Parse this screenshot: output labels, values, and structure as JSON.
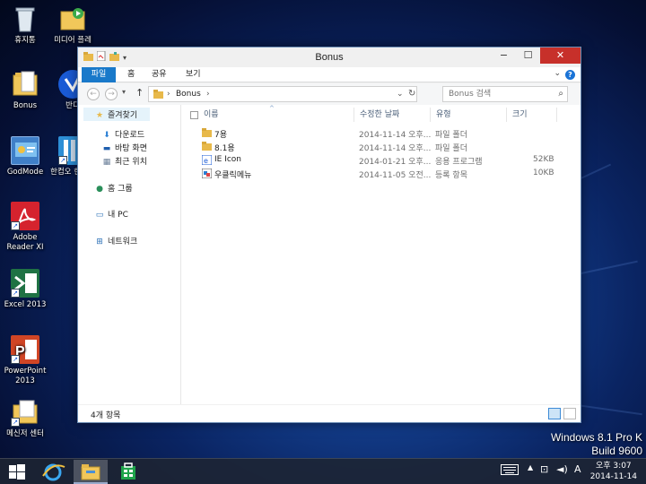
{
  "desktop": {
    "icons": [
      {
        "label": "휴지통",
        "icon": "recycle-bin-icon"
      },
      {
        "label": "Bonus",
        "icon": "folder-icon"
      },
      {
        "label": "GodMode",
        "icon": "control-panel-icon"
      },
      {
        "label": "Adobe Reader XI",
        "icon": "adobe-reader-icon"
      },
      {
        "label": "Excel 2013",
        "icon": "excel-icon"
      },
      {
        "label": "PowerPoint 2013",
        "icon": "powerpoint-icon"
      },
      {
        "label": "메신저 센터",
        "icon": "messenger-folder-icon"
      },
      {
        "label": "미디어 플레",
        "icon": "media-player-folder-icon"
      },
      {
        "label": "반디",
        "icon": "bandi-icon"
      },
      {
        "label": "한컴오 한글 2",
        "icon": "hangul-icon"
      }
    ],
    "watermark": {
      "line1": "Windows 8.1 Pro K",
      "line2": "Build 9600"
    }
  },
  "window": {
    "title": "Bonus",
    "controls": {
      "minimize": "−",
      "maximize": "☐",
      "close": "✕"
    },
    "ribbon_tabs": [
      "파일",
      "홈",
      "공유",
      "보기"
    ],
    "address": {
      "crumbs": [
        "Bonus"
      ]
    },
    "search": {
      "placeholder": "Bonus 검색"
    },
    "nav_pane": {
      "favorites": "즐겨찾기",
      "favorite_items": [
        "다운로드",
        "바탕 화면",
        "최근 위치"
      ],
      "homegroup": "홈 그룹",
      "this_pc": "내 PC",
      "network": "네트워크"
    },
    "columns": [
      "이름",
      "수정한 날짜",
      "유형",
      "크기"
    ],
    "files": [
      {
        "name": "7용",
        "date": "2014-11-14 오후...",
        "type": "파일 폴더",
        "size": "",
        "icon": "folder-icon"
      },
      {
        "name": "8.1용",
        "date": "2014-11-14 오후...",
        "type": "파일 폴더",
        "size": "",
        "icon": "folder-icon"
      },
      {
        "name": "IE Icon",
        "date": "2014-01-21 오후...",
        "type": "응용 프로그램",
        "size": "52KB",
        "icon": "application-icon"
      },
      {
        "name": "우클릭메뉴",
        "date": "2014-11-05 오전...",
        "type": "등록 항목",
        "size": "10KB",
        "icon": "registry-file-icon"
      }
    ],
    "status": "4개 항목"
  },
  "taskbar": {
    "apps": [
      "start-icon",
      "internet-explorer-icon",
      "file-explorer-icon",
      "store-icon"
    ],
    "ime": "A",
    "clock": {
      "time": "오후 3:07",
      "date": "2014-11-14"
    }
  },
  "colors": {
    "accent": "#1979ca",
    "close": "#c7302a",
    "folder": "#e8b94a"
  }
}
